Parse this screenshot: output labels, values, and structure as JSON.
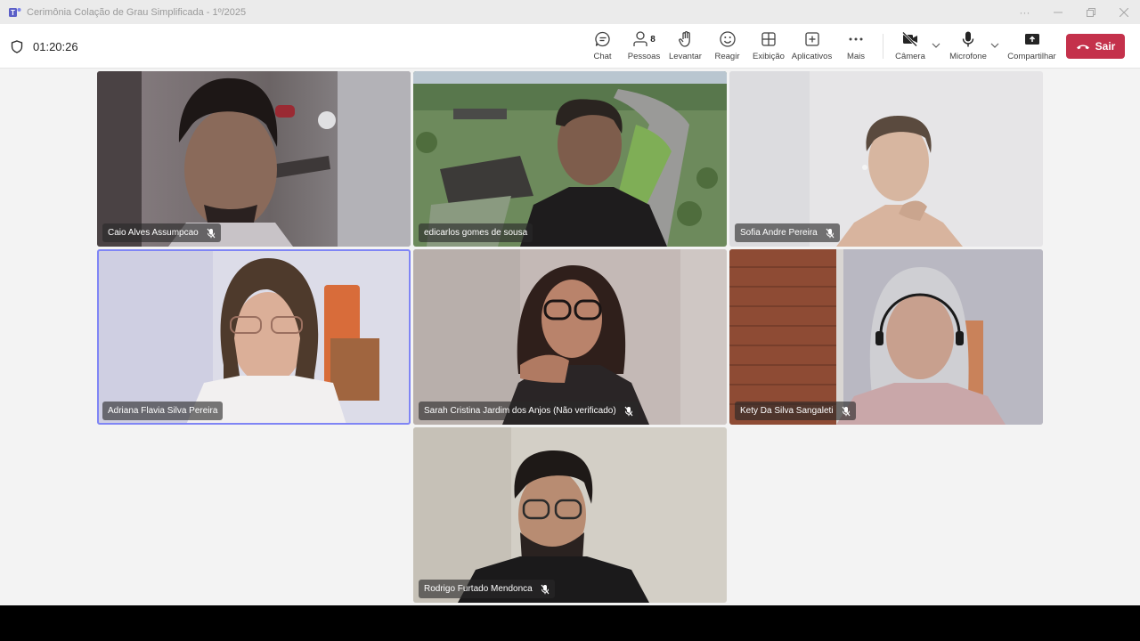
{
  "window": {
    "title": "Cerimônia Colação de Grau Simplificada - 1º/2025",
    "controls": [
      "more-icon",
      "minimize-icon",
      "restore-icon",
      "close-icon"
    ]
  },
  "meeting": {
    "timer": "01:20:26"
  },
  "toolbar": {
    "chat": "Chat",
    "people": "Pessoas",
    "people_count": "8",
    "raise": "Levantar",
    "react": "Reagir",
    "view": "Exibição",
    "apps": "Aplicativos",
    "more": "Mais",
    "camera": "Câmera",
    "mic": "Microfone",
    "share": "Compartilhar",
    "leave": "Sair"
  },
  "colors": {
    "leave": "#c4314b",
    "active_speaker": "#7f85f5",
    "stage_bg": "#f3f3f3"
  },
  "participants": [
    {
      "name": "Caio Alves Assumpcao",
      "muted": true
    },
    {
      "name": "edicarlos gomes de sousa",
      "muted": false
    },
    {
      "name": "Sofia Andre Pereira",
      "muted": true
    },
    {
      "name": "Adriana Flavia Silva Pereira",
      "muted": false,
      "speaking": true
    },
    {
      "name": "Sarah Cristina Jardim dos Anjos (Não verificado)",
      "muted": true
    },
    {
      "name": "Kety Da Silva Sangaleti",
      "muted": true
    },
    {
      "name": "Rodrigo Furtado Mendonca",
      "muted": true
    }
  ]
}
